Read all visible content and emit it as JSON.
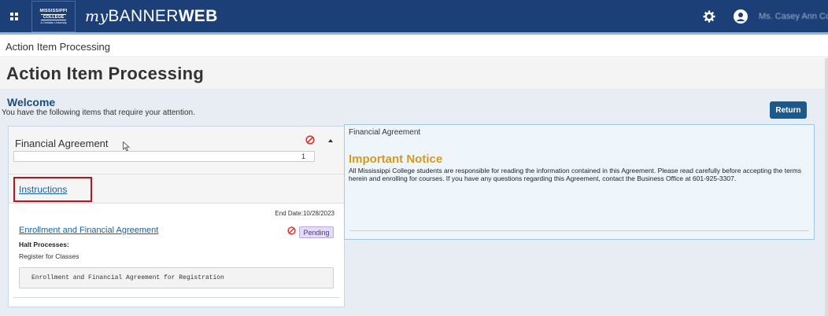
{
  "topbar": {
    "logo_line1": "MISSISSIPPI",
    "logo_line2": "COLLEGE",
    "logo_line3": "A Christian University",
    "app_name_my": "my",
    "app_name_banner": "BANNER",
    "app_name_web": "WEB",
    "user_name": "Ms. Casey Ann Cole"
  },
  "breadcrumb": "Action Item Processing",
  "page_title": "Action Item Processing",
  "welcome": {
    "heading": "Welcome",
    "subtext": "You have the following items that require your attention."
  },
  "return_button": "Return",
  "left_panel": {
    "group_title": "Financial Agreement",
    "count": "1",
    "instructions_link": "Instructions",
    "end_date": "End Date:10/28/2023",
    "item_title": "Enrollment and Financial Agreement",
    "status": "Pending",
    "halt_label": "Halt Processes:",
    "halt_value": "Register for Classes",
    "agreement_text": "Enrollment and Financial Agreement for Registration"
  },
  "right_panel": {
    "title": "Financial Agreement",
    "notice_heading": "Important Notice",
    "body": "All Mississippi College students are responsible for reading the information contained in this Agreement. Please read carefully before accepting the terms herein and enrolling for courses. If you have any questions regarding this Agreement, contact the Business Office at 601-925-3307."
  },
  "colors": {
    "topbar_bg": "#1c3f77",
    "link": "#1a5f9e",
    "notice": "#d29b1c",
    "halt_red": "#d9342b",
    "highlight_box": "#b3171d",
    "return_btn": "#1c5a8c",
    "pending_badge": "#e6dcf8"
  },
  "icons": [
    "grid-menu-icon",
    "gear-icon",
    "user-icon",
    "halt-icon",
    "caret-up-icon",
    "pointer-cursor-icon"
  ]
}
